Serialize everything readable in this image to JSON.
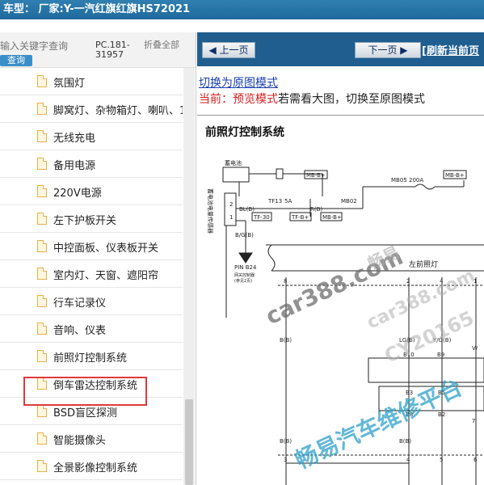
{
  "window": {
    "title": "车型： 厂家:Y-一汽红旗红旗HS72021"
  },
  "sidebar": {
    "search_placeholder": "输入关键字查询",
    "search_button": "查询",
    "pc_label": "PC.181-31957",
    "fold_all": "折叠全部",
    "items": [
      {
        "label": "氛围灯"
      },
      {
        "label": "脚窝灯、杂物箱灯、喇叭、1"
      },
      {
        "label": "无线充电"
      },
      {
        "label": "备用电源"
      },
      {
        "label": "220V电源"
      },
      {
        "label": "左下护板开关"
      },
      {
        "label": "中控面板、仪表板开关"
      },
      {
        "label": "室内灯、天窗、遮阳帘"
      },
      {
        "label": "行车记录仪"
      },
      {
        "label": "音响、仪表"
      },
      {
        "label": "前照灯控制系统"
      },
      {
        "label": "倒车雷达控制系统"
      },
      {
        "label": "BSD盲区探测"
      },
      {
        "label": "智能摄像头"
      },
      {
        "label": "全景影像控制系统"
      }
    ],
    "selected_index": 10
  },
  "viewer": {
    "prev_label": "上一页",
    "next_label": "下一页",
    "refresh_label": "[刷新当前页",
    "switch_link": "切换为原图模式",
    "mode_prefix": "当前：",
    "mode_current": "预览模式",
    "mode_hint": "若需看大图，切换至原图模式"
  },
  "diagram": {
    "title": "前照灯控制系统",
    "labels": {
      "battery": "蓄电池",
      "fuse_box": "蓄电池电量传感器",
      "mb_b1": "MB-B+",
      "mb_b2": "MB-B+",
      "mb05": "MB05",
      "mb05_rating": "200A",
      "tf13": "TF13",
      "tf13_rating": "5A",
      "mb02": "MB02",
      "bl_b": "BL(B)",
      "r_b": "R(B)",
      "tf30": "TF-30",
      "tf_b": "TF-B+",
      "mb_b3": "MB-B+",
      "pin_num": "2",
      "pin_num2": "1",
      "bg_b": "B/G(B)",
      "pin_b24": "PIN B24",
      "pin_note1": "网关控制器",
      "pin_note2": "(参见2页)",
      "headlamp": "左前照灯",
      "c8": "8",
      "c2": "2",
      "c4": "4",
      "c1": "1",
      "b_b": "B(B)",
      "lg_b": "LG(B)",
      "y_g_b": "Y/G(B)",
      "b10": "B10",
      "b9": "B9",
      "b3": "B3",
      "b5": "B5",
      "b8": "B8",
      "b2": "B2",
      "b_b2": "B(B)",
      "c3": "3",
      "b_b3": "B(B)",
      "c4b": "4",
      "c5": "5",
      "c6": "6",
      "c7": "7",
      "v_l": "V/"
    },
    "watermarks": {
      "wm1": "car388.com",
      "wm2": "畅易",
      "wm3": "car388.com",
      "wm4": "CY20165",
      "wm5": "畅易汽车维修平台"
    }
  },
  "colors": {
    "title_bar": "#2f7fb0",
    "nav_bar": "#1f5e8f",
    "highlight_border": "#e03a3a",
    "link": "#1a3fb0",
    "mode_red": "#d81e1e",
    "watermark_blue": "#2da0c8"
  }
}
